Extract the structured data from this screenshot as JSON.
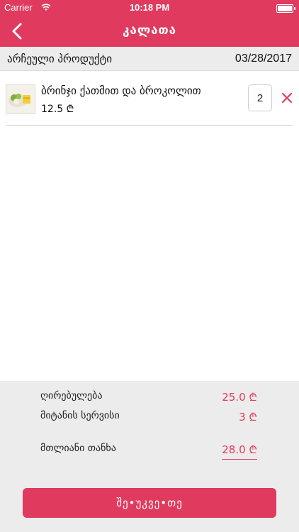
{
  "status_bar": {
    "carrier": "Carrier",
    "time": "10:18 PM",
    "battery_level": 1.0
  },
  "navbar": {
    "title": "კალათა",
    "back_icon": "chevron-left-icon"
  },
  "section": {
    "label": "არჩეული პროდუქტი",
    "date": "03/28/2017"
  },
  "cart": {
    "items": [
      {
        "name": "ბრინჯი ქათმით და ბროკოლით",
        "price": "12.5 ₾",
        "quantity": "2",
        "remove_icon": "close-icon"
      }
    ]
  },
  "summary": {
    "subtotal_label": "ღირებულება",
    "subtotal_value": "25.0 ₾",
    "delivery_label": "მიტანის სერვისი",
    "delivery_value": "3 ₾",
    "total_label": "მთლიანი თანხა",
    "total_value": "28.0 ₾"
  },
  "checkout_label": "შე•უკვე•თე",
  "colors": {
    "accent": "#e03a5e",
    "summary_bg": "#ececec"
  }
}
